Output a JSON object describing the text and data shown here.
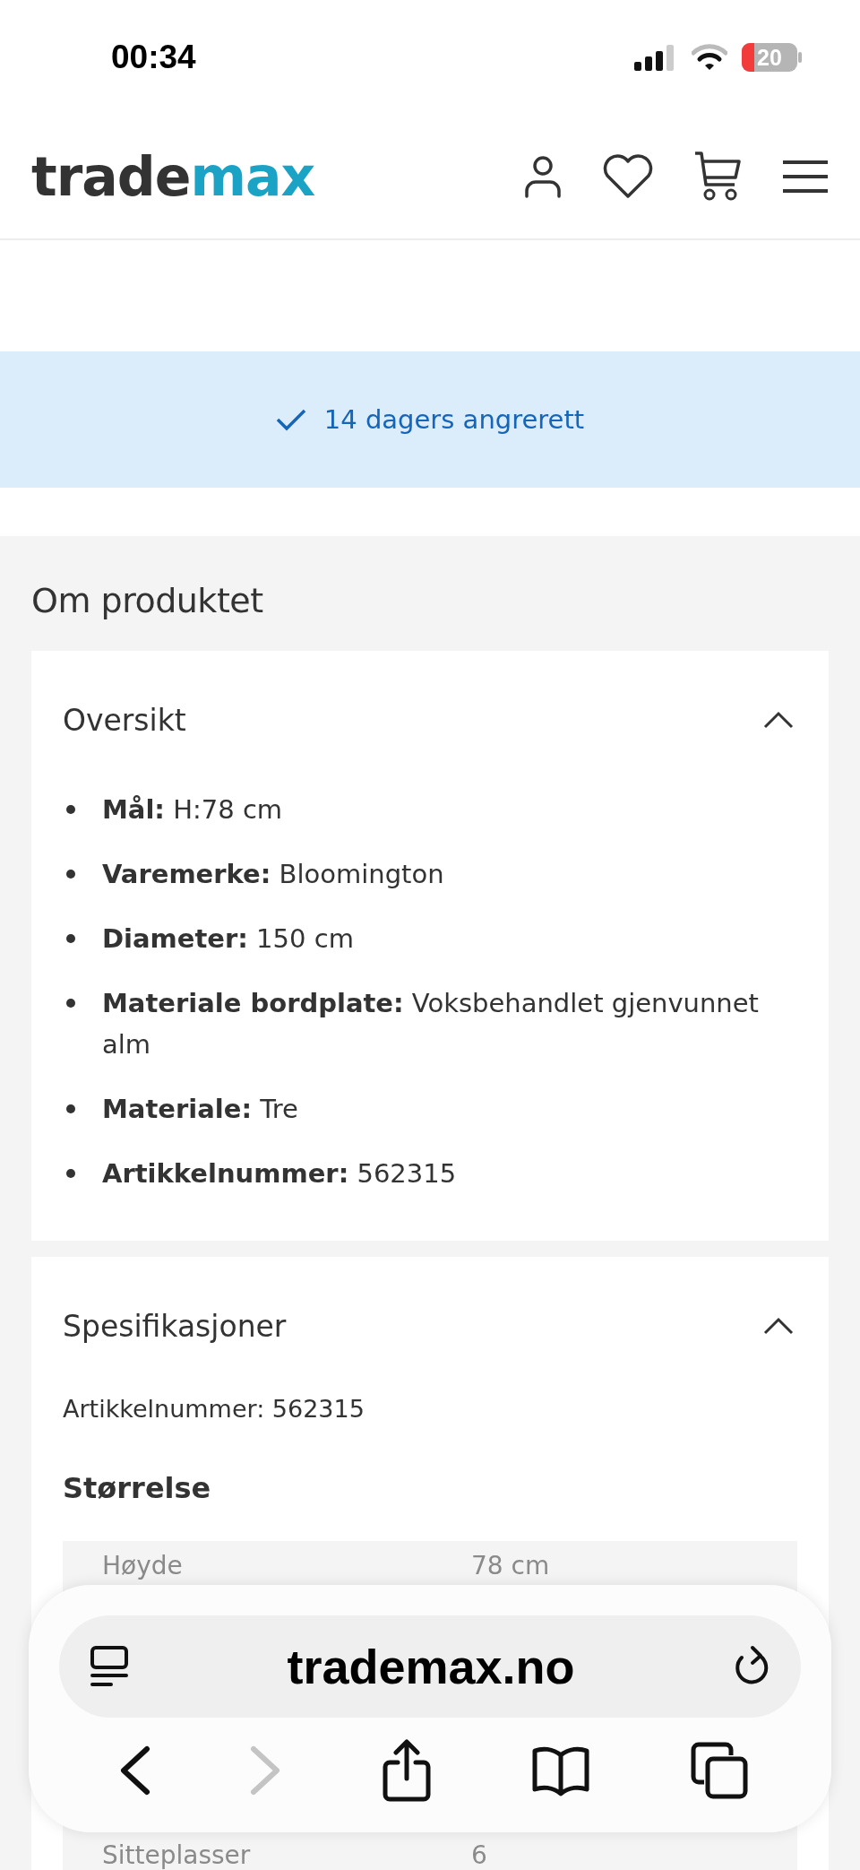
{
  "status_bar": {
    "time": "00:34",
    "battery": "20"
  },
  "header": {
    "logo": {
      "primary": "trade",
      "accent": "max"
    }
  },
  "banner": {
    "text": "14 dagers angrerett"
  },
  "about": {
    "heading": "Om produktet",
    "sections": [
      {
        "kind": "bullets",
        "title": "Oversikt",
        "expanded": true,
        "items": [
          {
            "label": "Mål:",
            "value": "H:78 cm"
          },
          {
            "label": "Varemerke:",
            "value": "Bloomington"
          },
          {
            "label": "Diameter:",
            "value": "150 cm"
          },
          {
            "label": "Materiale bordplate:",
            "value": "Voksbehandlet gjenvunnet alm"
          },
          {
            "label": "Materiale:",
            "value": "Tre"
          },
          {
            "label": "Artikkelnummer:",
            "value": "562315"
          }
        ]
      },
      {
        "kind": "specs",
        "title": "Spesifikasjoner",
        "expanded": true,
        "article": "Artikkelnummer: 562315",
        "subheading": "Størrelse",
        "rows": [
          {
            "label": "Høyde",
            "value": "78 cm"
          },
          {
            "label": "Sitteplasser",
            "value": "6"
          }
        ]
      }
    ]
  },
  "browser_bar": {
    "url": "trademax.no",
    "back_disabled": false,
    "forward_disabled": true
  }
}
